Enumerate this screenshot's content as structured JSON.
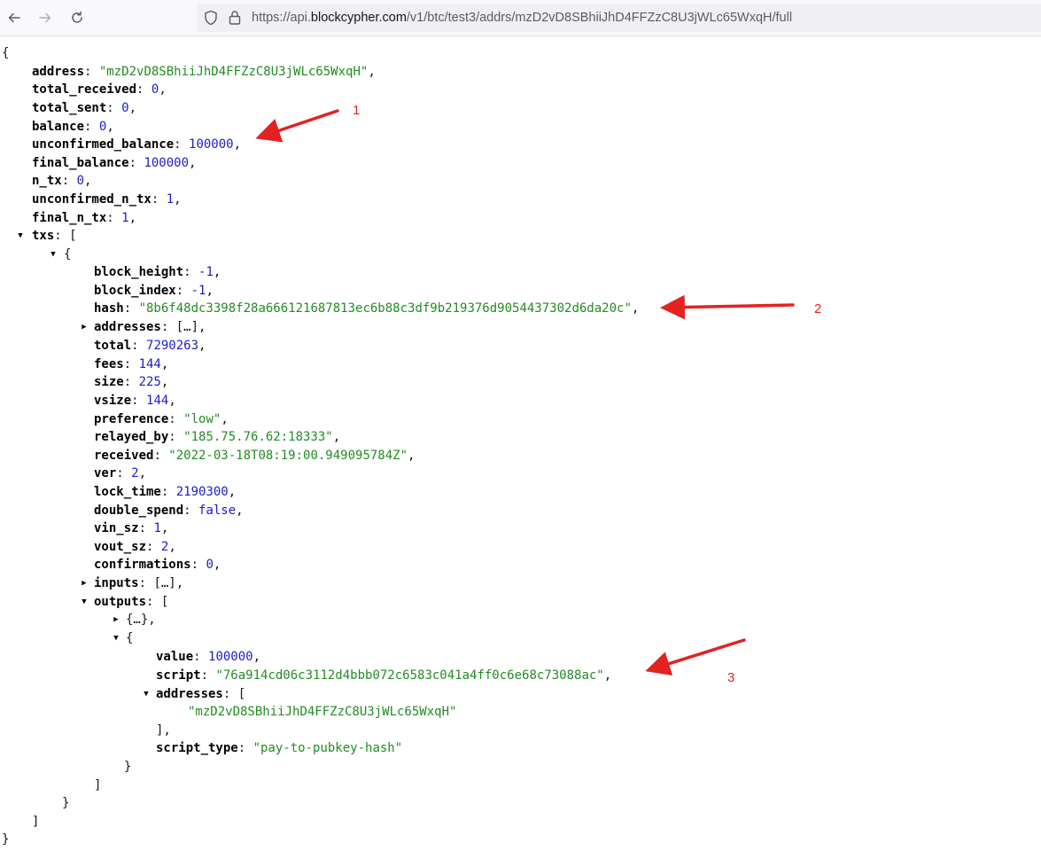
{
  "browser": {
    "url_prefix": "https://api.",
    "url_domain": "blockcypher.com",
    "url_path": "/v1/btc/test3/addrs/mzD2vD8SBhiiJhD4FFZzC8U3jWLc65WxqH/full"
  },
  "json": {
    "open_brace": "{",
    "close_brace": "}",
    "address_key": "address",
    "address_val": "\"mzD2vD8SBhiiJhD4FFZzC8U3jWLc65WxqH\"",
    "total_received_key": "total_received",
    "total_received_val": "0",
    "total_sent_key": "total_sent",
    "total_sent_val": "0",
    "balance_key": "balance",
    "balance_val": "0",
    "unconfirmed_balance_key": "unconfirmed_balance",
    "unconfirmed_balance_val": "100000",
    "final_balance_key": "final_balance",
    "final_balance_val": "100000",
    "n_tx_key": "n_tx",
    "n_tx_val": "0",
    "unconfirmed_n_tx_key": "unconfirmed_n_tx",
    "unconfirmed_n_tx_val": "1",
    "final_n_tx_key": "final_n_tx",
    "final_n_tx_val": "1",
    "txs_key": "txs",
    "tx": {
      "block_height_key": "block_height",
      "block_height_val": "-1",
      "block_index_key": "block_index",
      "block_index_val": "-1",
      "hash_key": "hash",
      "hash_val": "\"8b6f48dc3398f28a666121687813ec6b88c3df9b219376d9054437302d6da20c\"",
      "addresses_key": "addresses",
      "collapsed_array": "[…]",
      "total_key": "total",
      "total_val": "7290263",
      "fees_key": "fees",
      "fees_val": "144",
      "size_key": "size",
      "size_val": "225",
      "vsize_key": "vsize",
      "vsize_val": "144",
      "preference_key": "preference",
      "preference_val": "\"low\"",
      "relayed_by_key": "relayed_by",
      "relayed_by_val": "\"185.75.76.62:18333\"",
      "received_key": "received",
      "received_val": "\"2022-03-18T08:19:00.949095784Z\"",
      "ver_key": "ver",
      "ver_val": "2",
      "lock_time_key": "lock_time",
      "lock_time_val": "2190300",
      "double_spend_key": "double_spend",
      "double_spend_val": "false",
      "vin_sz_key": "vin_sz",
      "vin_sz_val": "1",
      "vout_sz_key": "vout_sz",
      "vout_sz_val": "2",
      "confirmations_key": "confirmations",
      "confirmations_val": "0",
      "inputs_key": "inputs",
      "inputs_collapsed": "[…]",
      "outputs_key": "outputs",
      "collapsed_object": "{…}",
      "output": {
        "value_key": "value",
        "value_val": "100000",
        "script_key": "script",
        "script_val": "\"76a914cd06c3112d4bbb072c6583c041a4ff0c6e68c73088ac\"",
        "addresses_key": "addresses",
        "address_item": "\"mzD2vD8SBhiiJhD4FFZzC8U3jWLc65WxqH\"",
        "script_type_key": "script_type",
        "script_type_val": "\"pay-to-pubkey-hash\""
      }
    }
  },
  "annotations": {
    "label_1": "1",
    "label_2": "2",
    "label_3": "3",
    "color": "#e32222"
  }
}
